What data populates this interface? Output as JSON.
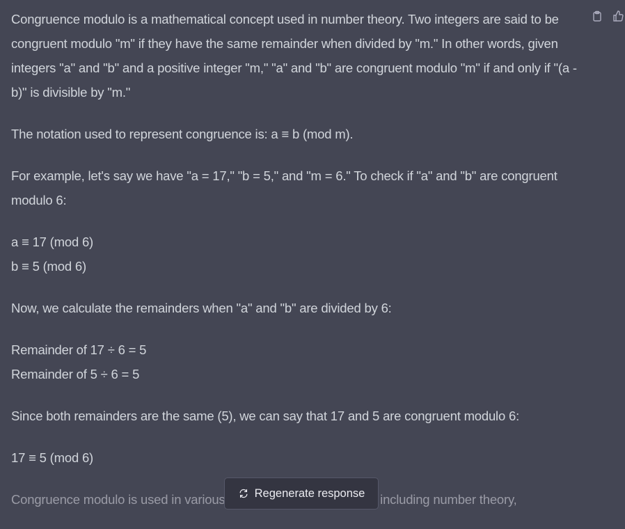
{
  "message": {
    "paragraphs": [
      [
        "Congruence modulo is a mathematical concept used in number theory. Two integers are said to be congruent modulo \"m\" if they have the same remainder when divided by \"m.\" In other words, given integers \"a\" and \"b\" and a positive integer \"m,\" \"a\" and \"b\" are congruent modulo \"m\" if and only if \"(a - b)\" is divisible by \"m.\""
      ],
      [
        "The notation used to represent congruence is: a ≡ b (mod m)."
      ],
      [
        "For example, let's say we have \"a = 17,\" \"b = 5,\" and \"m = 6.\" To check if \"a\" and \"b\" are congruent modulo 6:"
      ],
      [
        "a ≡ 17 (mod 6)",
        "b ≡ 5 (mod 6)"
      ],
      [
        "Now, we calculate the remainders when \"a\" and \"b\" are divided by 6:"
      ],
      [
        "Remainder of 17 ÷ 6 = 5",
        "Remainder of 5 ÷ 6 = 5"
      ],
      [
        "Since both remainders are the same (5), we can say that 17 and 5 are congruent modulo 6:"
      ],
      [
        "17 ≡ 5 (mod 6)"
      ]
    ],
    "faded_paragraph": "Congruence modulo is used in various mathematical applications, including number theory,"
  },
  "actions": {
    "copy_icon": "clipboard-icon",
    "like_icon": "thumbs-up-icon"
  },
  "regenerate": {
    "label": "Regenerate response",
    "icon": "refresh-icon"
  },
  "colors": {
    "background": "#444654",
    "text": "#d1d5db",
    "button_bg": "#343541"
  }
}
